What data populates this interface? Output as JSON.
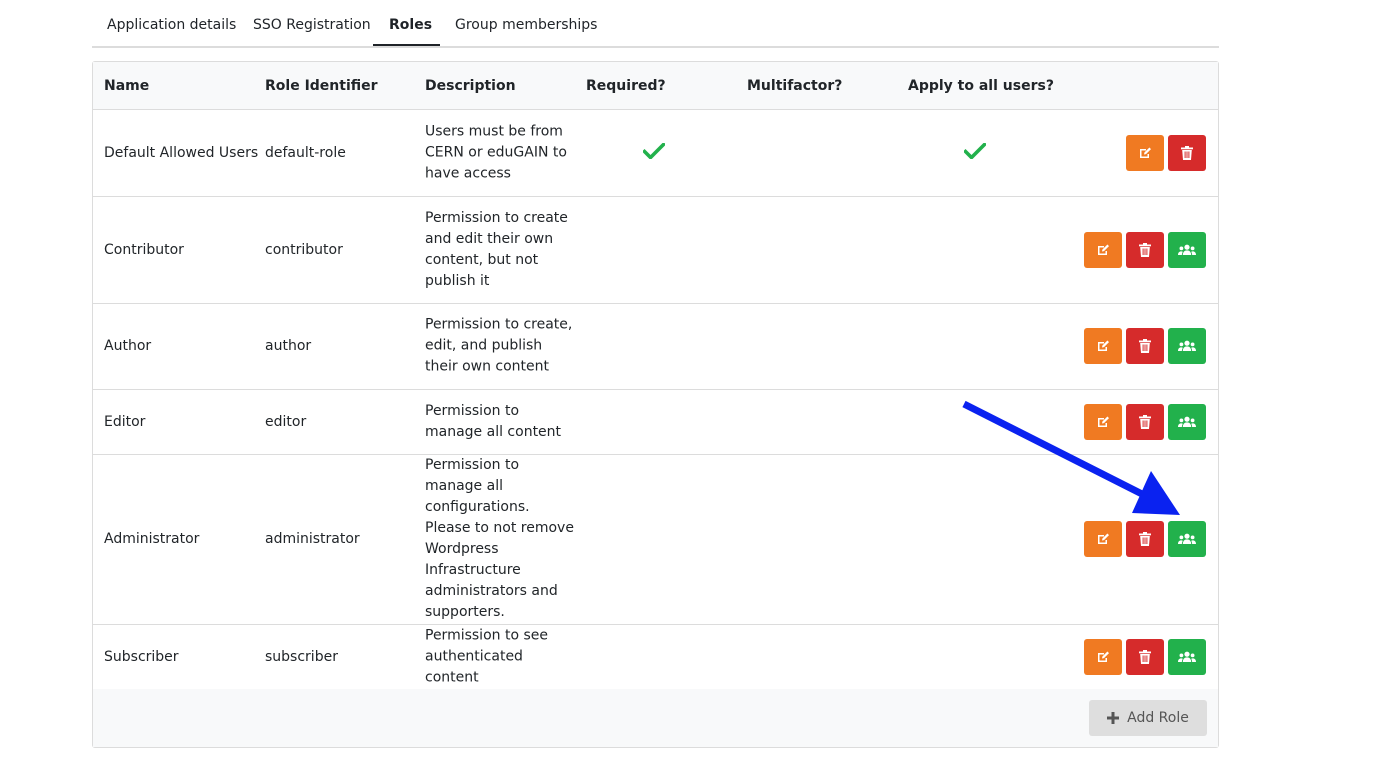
{
  "tabs": [
    {
      "label": "Application details"
    },
    {
      "label": "SSO Registration"
    },
    {
      "label": "Roles"
    },
    {
      "label": "Group memberships"
    }
  ],
  "active_tab": "Roles",
  "table": {
    "headers": [
      "Name",
      "Role Identifier",
      "Description",
      "Required?",
      "Multifactor?",
      "Apply to all users?"
    ],
    "rows": [
      {
        "name": "Default Allowed Users",
        "identifier": "default-role",
        "description": "Users must be from CERN or eduGAIN to have access",
        "required": true,
        "multifactor": false,
        "apply_all": true
      },
      {
        "name": "Contributor",
        "identifier": "contributor",
        "description": "Permission to create and edit their own content, but not publish it",
        "required": false,
        "multifactor": false,
        "apply_all": false
      },
      {
        "name": "Author",
        "identifier": "author",
        "description": "Permission to create, edit, and publish their own content",
        "required": false,
        "multifactor": false,
        "apply_all": false
      },
      {
        "name": "Editor",
        "identifier": "editor",
        "description": "Permission to manage all content",
        "required": false,
        "multifactor": false,
        "apply_all": false
      },
      {
        "name": "Administrator",
        "identifier": "administrator",
        "description": "Permission to manage all configurations. Please to not remove Wordpress Infrastructure administrators and supporters.",
        "required": false,
        "multifactor": false,
        "apply_all": false
      },
      {
        "name": "Subscriber",
        "identifier": "subscriber",
        "description": "Permission to see authenticated content",
        "required": false,
        "multifactor": false,
        "apply_all": false
      }
    ]
  },
  "add_role_label": "Add Role",
  "icons": {
    "edit": "edit-icon",
    "delete": "trash-icon",
    "members": "users-icon",
    "check": "check-icon",
    "add": "plus-icon"
  },
  "colors": {
    "edit": "#f07a22",
    "delete": "#d62b2b",
    "members": "#22b14c",
    "check": "#22b14c",
    "annotation_arrow": "#0a22f0"
  }
}
